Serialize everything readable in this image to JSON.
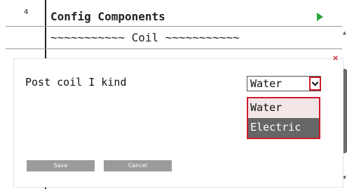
{
  "editor": {
    "line_number": "4",
    "line1": "Config Components",
    "line2": "~~~~~~~~~~~ Coil ~~~~~~~~~~~"
  },
  "dialog": {
    "close_label": "×",
    "field_label": "Post coil I kind",
    "select_value": "Water",
    "options": [
      "Water",
      "Electric"
    ],
    "highlighted_option": "Electric",
    "save_label": "Save",
    "cancel_label": "Cancel"
  },
  "colors": {
    "highlight_border": "#d11a2a",
    "run_icon": "#2aa33a",
    "selected_option_bg": "#666666",
    "button_bg": "#9b9b9b"
  },
  "icons": {
    "run": "play-icon",
    "close": "close-icon",
    "dropdown": "chevron-down-icon"
  }
}
